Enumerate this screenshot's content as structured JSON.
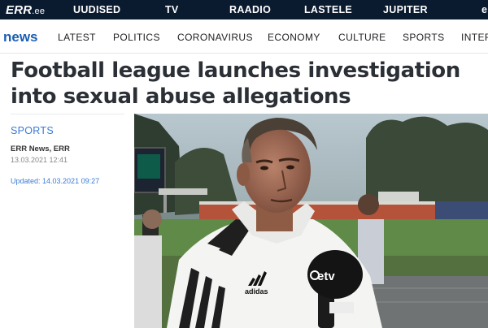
{
  "top_bar": {
    "logo": "ERR",
    "logo_suffix": ".ee",
    "items": [
      "UUDISED",
      "TV",
      "RAADIO",
      "LASTELE",
      "JUPITER",
      "e"
    ]
  },
  "section_nav": {
    "brand": "news",
    "items": [
      "LATEST",
      "POLITICS",
      "CORONAVIRUS",
      "ECONOMY",
      "CULTURE",
      "SPORTS",
      "INTER"
    ]
  },
  "article": {
    "headline": "Football league launches investigation into sexual abuse allegations",
    "category": "SPORTS",
    "author": "ERR News, ERR",
    "date": "13.03.2021 12:41",
    "updated": "Updated: 14.03.2021 09:27"
  },
  "photo": {
    "microphone_logo": "etv",
    "jacket_brand": "adidas"
  },
  "colors": {
    "top_bar_bg": "#0a1a2f",
    "brand_blue": "#1a5fb4",
    "link_blue": "#3a7bd5",
    "headline_text": "#2b2f36"
  }
}
